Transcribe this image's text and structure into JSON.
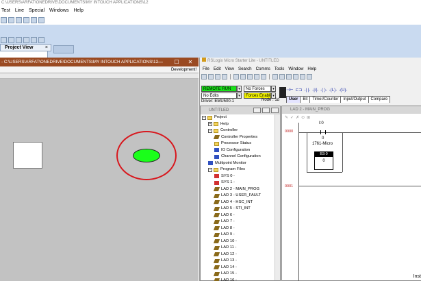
{
  "backapp": {
    "title": "C:\\USERS\\ARFAT\\ONEDRIVE\\DOCUMENTS\\MY INTOUCH APPLICATIONS\\12",
    "menu": [
      "Test",
      "Line",
      "Special",
      "Windows",
      "Help"
    ],
    "project_view": "Project View",
    "close_glyph": "×"
  },
  "intouch": {
    "title": "- C:\\USERS\\ARFAT\\ONEDRIVE\\DOCUMENTS\\MY INTOUCH APPLICATIONS\\12",
    "minimize": "—",
    "maximize": "☐",
    "close": "✕",
    "mode": "Development!",
    "shapes": {
      "ellipse_color": "#1aff1a",
      "ring_color": "#d8171d"
    }
  },
  "rslogix": {
    "title": "RSLogix Micro Starter Lite - UNTITLED",
    "menu": [
      "File",
      "Edit",
      "View",
      "Search",
      "Comms",
      "Tools",
      "Window",
      "Help"
    ],
    "status": {
      "run_mode": "REMOTE RUN",
      "forces": "No Forces",
      "edits": "No Edits",
      "forces_enabled": "Forces Enabled",
      "driver": "Driver: EMU500-1",
      "node": "Node : 1d"
    },
    "tabs": [
      "User",
      "Bit",
      "Timer/Counter",
      "Input/Output",
      "Compare"
    ],
    "project_pane_title": "UNTITLED",
    "tree": [
      {
        "label": "Project",
        "icon": "folder",
        "indent": 0,
        "expander": "-"
      },
      {
        "label": "Help",
        "icon": "folder",
        "indent": 1,
        "expander": "+"
      },
      {
        "label": "Controller",
        "icon": "folder",
        "indent": 1,
        "expander": "-"
      },
      {
        "label": "Controller Properties",
        "icon": "properties",
        "indent": 2,
        "expander": ""
      },
      {
        "label": "Processor Status",
        "icon": "status",
        "indent": 2,
        "expander": ""
      },
      {
        "label": "IO Configuration",
        "icon": "io",
        "indent": 2,
        "expander": ""
      },
      {
        "label": "Channel Configuration",
        "icon": "channel",
        "indent": 2,
        "expander": ""
      },
      {
        "label": "Multipoint Monitor",
        "icon": "monitor",
        "indent": 1,
        "expander": ""
      },
      {
        "label": "Program Files",
        "icon": "folder",
        "indent": 1,
        "expander": "-"
      },
      {
        "label": "SYS 0 -",
        "icon": "sys",
        "indent": 2,
        "expander": ""
      },
      {
        "label": "SYS 1 -",
        "icon": "sys",
        "indent": 2,
        "expander": ""
      },
      {
        "label": "LAD 2 - MAIN_PROG",
        "icon": "ladder",
        "indent": 2,
        "expander": ""
      },
      {
        "label": "LAD 3 - USER_FAULT",
        "icon": "ladder",
        "indent": 2,
        "expander": ""
      },
      {
        "label": "LAD 4 - HSC_INT",
        "icon": "ladder",
        "indent": 2,
        "expander": ""
      },
      {
        "label": "LAD 5 - STI_INT",
        "icon": "ladder",
        "indent": 2,
        "expander": ""
      },
      {
        "label": "LAD 6 -",
        "icon": "ladder",
        "indent": 2,
        "expander": ""
      },
      {
        "label": "LAD 7 -",
        "icon": "ladder",
        "indent": 2,
        "expander": ""
      },
      {
        "label": "LAD 8 -",
        "icon": "ladder",
        "indent": 2,
        "expander": ""
      },
      {
        "label": "LAD 9 -",
        "icon": "ladder",
        "indent": 2,
        "expander": ""
      },
      {
        "label": "LAD 10 -",
        "icon": "ladder",
        "indent": 2,
        "expander": ""
      },
      {
        "label": "LAD 11 -",
        "icon": "ladder",
        "indent": 2,
        "expander": ""
      },
      {
        "label": "LAD 12 -",
        "icon": "ladder",
        "indent": 2,
        "expander": ""
      },
      {
        "label": "LAD 13 -",
        "icon": "ladder",
        "indent": 2,
        "expander": ""
      },
      {
        "label": "LAD 14 -",
        "icon": "ladder",
        "indent": 2,
        "expander": ""
      },
      {
        "label": "LAD 15 -",
        "icon": "ladder",
        "indent": 2,
        "expander": ""
      },
      {
        "label": "LAD 16 -",
        "icon": "ladder",
        "indent": 2,
        "expander": ""
      }
    ],
    "ladder": {
      "title": "LAD 2 - MAIN_PROG",
      "rung0": "0000",
      "rung1": "0001",
      "contact_addr": "I:0",
      "contact_bit": "0",
      "contact_desc": "1761-Micro",
      "box_header": "B3:0",
      "box_value": "0"
    },
    "inst": "Inst"
  }
}
